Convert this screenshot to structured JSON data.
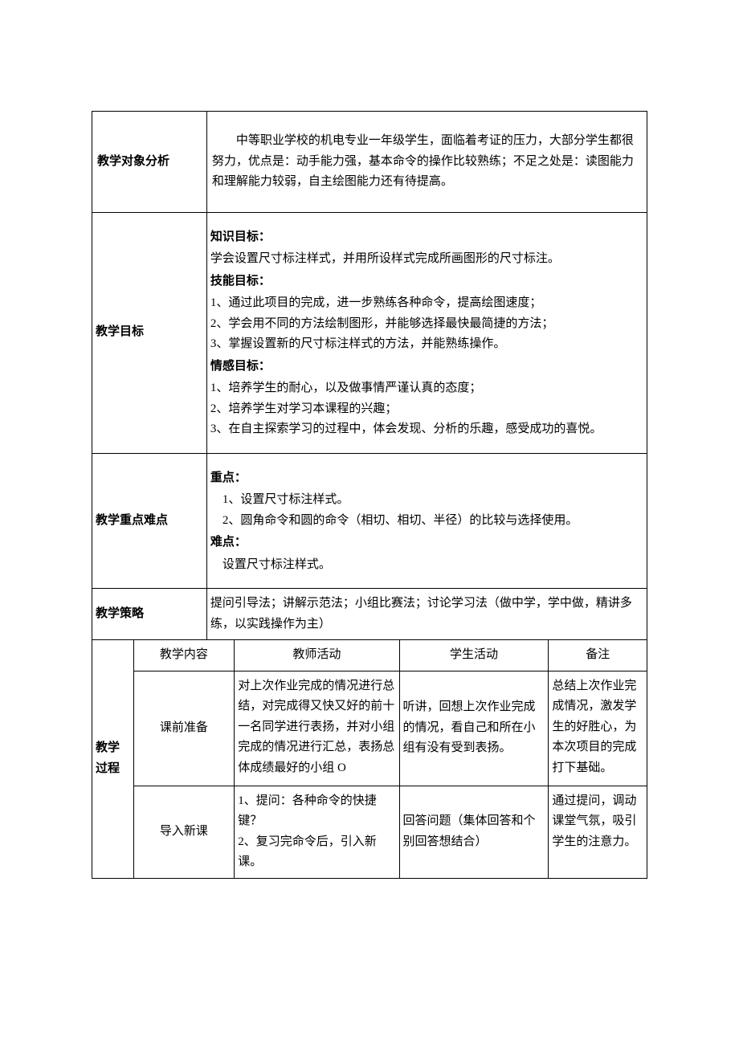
{
  "rows": {
    "audience": {
      "label": "教学对象分析",
      "text": "中等职业学校的机电专业一年级学生，面临着考证的压力，大部分学生都很努力，优点是：动手能力强，基本命令的操作比较熟练；不足之处是：读图能力和理解能力较弱，自主绘图能力还有待提高。"
    },
    "objectives": {
      "label": "教学目标",
      "h1": "知识目标：",
      "p1": "学会设置尺寸标注样式，并用所设样式完成所画图形的尺寸标注。",
      "h2": "技能目标：",
      "p2a": "1、通过此项目的完成，进一步熟练各种命令，提高绘图速度；",
      "p2b": "2、学会用不同的方法绘制图形，并能够选择最快最简捷的方法；",
      "p2c": "3、掌握设置新的尺寸标注样式的方法，并能熟练操作。",
      "h3": "情感目标：",
      "p3a": "1、培养学生的耐心，以及做事情严谨认真的态度；",
      "p3b": "2、培养学生对学习本课程的兴趣；",
      "p3c": "3、在自主探索学习的过程中，体会发现、分析的乐趣，感受成功的喜悦。"
    },
    "focus": {
      "label": "教学重点难点",
      "h1": "重点：",
      "p1a": "　1、设置尺寸标注样式。",
      "p1b": "　2、圆角命令和圆的命令（相切、相切、半径）的比较与选择使用。",
      "h2": "难点：",
      "p2": "　设置尺寸标注样式。"
    },
    "strategy": {
      "label": "教学策略",
      "text": "提问引导法；讲解示范法；小组比赛法；讨论学习法（做中学，学中做，精讲多练，以实践操作为主）"
    }
  },
  "procTable": {
    "label": "教学过程",
    "headers": {
      "c1": "教学内容",
      "c2": "教师活动",
      "c3": "学生活动",
      "c4": "备注"
    },
    "r1": {
      "c1": "课前准备",
      "c2": "对上次作业完成的情况进行总结，对完成得又快又好的前十一名同学进行表扬，并对小组完成的情况进行汇总，表扬总体成绩最好的小组 O",
      "c3": "听讲，回想上次作业完成的情况，看自己和所在小组有没有受到表扬。",
      "c4": "总结上次作业完成情况，激发学生的好胜心，为本次项目的完成打下基础。"
    },
    "r2": {
      "c1": "导入新课",
      "c2": "1、提问：各种命令的快捷键？\n2、复习完命令后，引入新课。",
      "c3": "回答问题（集体回答和个别回答想结合）",
      "c4": "通过提问，调动课堂气氛，吸引学生的注意力。"
    }
  }
}
